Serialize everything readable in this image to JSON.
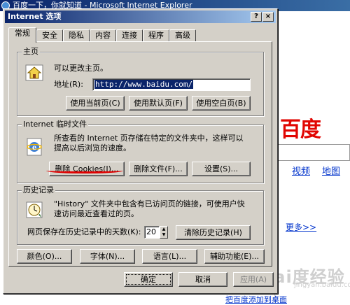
{
  "background": {
    "window_title": "百度一下，你就知道 - Microsoft Internet Explorer",
    "logo_text": "百度",
    "nav": [
      "视频",
      "地图"
    ],
    "more_link": "更多>>",
    "bottom_link": "把百度添加到桌面",
    "watermark": "Bai度经验",
    "watermark_sub": "jingyan.baidu.com"
  },
  "dialog": {
    "title": "Internet 选项",
    "help_glyph": "?",
    "close_glyph": "×",
    "tabs": [
      "常规",
      "安全",
      "隐私",
      "内容",
      "连接",
      "程序",
      "高级"
    ],
    "home": {
      "legend": "主页",
      "desc": "可以更改主页。",
      "address_label": "地址(R):",
      "address_value": "http://www.baidu.com/",
      "btn_current": "使用当前页(C)",
      "btn_default": "使用默认页(F)",
      "btn_blank": "使用空白页(B)"
    },
    "temp_files": {
      "legend": "Internet 临时文件",
      "desc_line1": "所查看的 Internet 页存储在特定的文件夹中，这样可以",
      "desc_line2": "提高以后浏览的速度。",
      "btn_cookies": "删除 Cookies(I)...",
      "btn_files": "删除文件(F)...",
      "btn_settings": "设置(S)..."
    },
    "history": {
      "legend": "历史记录",
      "desc_line1": "\"History\" 文件夹中包含有已访问页的链接，可使用户快",
      "desc_line2": "速访问最近查看过的页。",
      "days_label": "网页保存在历史记录中的天数(K):",
      "days_value": "20",
      "btn_clear": "清除历史记录(H)"
    },
    "bottom_buttons": [
      "颜色(O)...",
      "字体(N)...",
      "语言(L)...",
      "辅助功能(E)..."
    ],
    "ok": "确定",
    "cancel": "取消",
    "apply": "应用(A)"
  },
  "colors": {
    "dialog_face": "#d4d0c8",
    "titlebar": "#0a246a",
    "annotation_underline": "#e00000",
    "baidu_red": "#e10602"
  }
}
